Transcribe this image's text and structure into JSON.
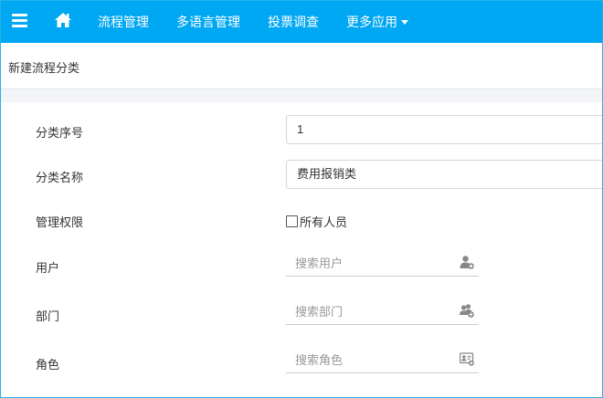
{
  "navbar": {
    "menu_icon": "hamburger-menu-icon",
    "home_icon": "home-icon",
    "items": [
      {
        "label": "流程管理"
      },
      {
        "label": "多语言管理"
      },
      {
        "label": "投票调查"
      },
      {
        "label": "更多应用"
      }
    ],
    "background": "#00a7f2"
  },
  "page": {
    "title": "新建流程分类"
  },
  "form": {
    "order_label": "分类序号",
    "order_value": "1",
    "name_label": "分类名称",
    "name_value": "费用报销类",
    "permission_label": "管理权限",
    "everyone_label": "所有人员",
    "everyone_checked": false,
    "user_label": "用户",
    "user_placeholder": "搜索用户",
    "user_icon": "user-add-icon",
    "dept_label": "部门",
    "dept_placeholder": "搜索部门",
    "dept_icon": "group-add-icon",
    "role_label": "角色",
    "role_placeholder": "搜索角色",
    "role_icon": "id-card-icon"
  }
}
